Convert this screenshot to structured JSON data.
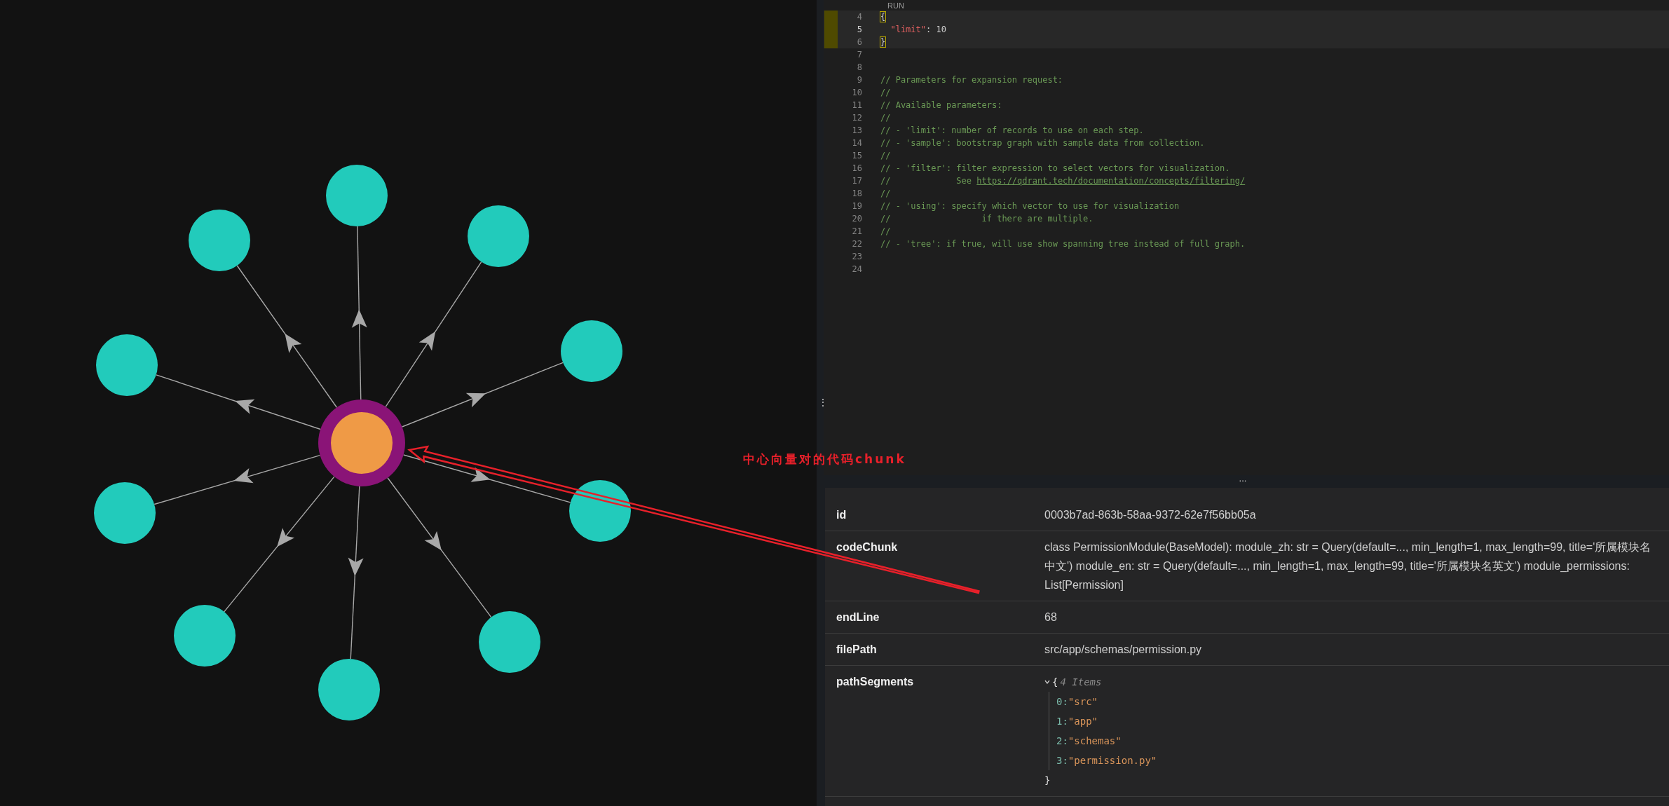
{
  "annotation": {
    "text": "中心向量对的代码chunk"
  },
  "editor": {
    "run_label": "RUN",
    "lines": [
      {
        "number": "4",
        "highlighted": true,
        "current": false,
        "tokens": [
          {
            "kind": "bracket",
            "text": "{"
          }
        ]
      },
      {
        "number": "5",
        "highlighted": true,
        "current": true,
        "tokens": [
          {
            "kind": "key",
            "text": "  \"limit\""
          },
          {
            "kind": "plain",
            "text": ": 10"
          }
        ]
      },
      {
        "number": "6",
        "highlighted": true,
        "current": false,
        "tokens": [
          {
            "kind": "bracket",
            "text": "}"
          }
        ]
      },
      {
        "number": "7",
        "highlighted": false,
        "current": false
      },
      {
        "number": "8",
        "highlighted": false,
        "current": false
      },
      {
        "number": "9",
        "highlighted": false,
        "current": false,
        "tokens": [
          {
            "kind": "comment",
            "text": "// Parameters for expansion request:"
          }
        ]
      },
      {
        "number": "10",
        "highlighted": false,
        "current": false,
        "tokens": [
          {
            "kind": "comment",
            "text": "//"
          }
        ]
      },
      {
        "number": "11",
        "highlighted": false,
        "current": false,
        "tokens": [
          {
            "kind": "comment",
            "text": "// Available parameters:"
          }
        ]
      },
      {
        "number": "12",
        "highlighted": false,
        "current": false,
        "tokens": [
          {
            "kind": "comment",
            "text": "//"
          }
        ]
      },
      {
        "number": "13",
        "highlighted": false,
        "current": false,
        "tokens": [
          {
            "kind": "comment",
            "text": "// - 'limit': number of records to use on each step."
          }
        ]
      },
      {
        "number": "14",
        "highlighted": false,
        "current": false,
        "tokens": [
          {
            "kind": "comment",
            "text": "// - 'sample': bootstrap graph with sample data from collection."
          }
        ]
      },
      {
        "number": "15",
        "highlighted": false,
        "current": false,
        "tokens": [
          {
            "kind": "comment",
            "text": "//"
          }
        ]
      },
      {
        "number": "16",
        "highlighted": false,
        "current": false,
        "tokens": [
          {
            "kind": "comment",
            "text": "// - 'filter': filter expression to select vectors for visualization."
          }
        ]
      },
      {
        "number": "17",
        "highlighted": false,
        "current": false,
        "tokens": [
          {
            "kind": "comment",
            "text": "//             See "
          },
          {
            "kind": "link",
            "text": "https://qdrant.tech/documentation/concepts/filtering/"
          }
        ]
      },
      {
        "number": "18",
        "highlighted": false,
        "current": false,
        "tokens": [
          {
            "kind": "comment",
            "text": "//"
          }
        ]
      },
      {
        "number": "19",
        "highlighted": false,
        "current": false,
        "tokens": [
          {
            "kind": "comment",
            "text": "// - 'using': specify which vector to use for visualization"
          }
        ]
      },
      {
        "number": "20",
        "highlighted": false,
        "current": false,
        "tokens": [
          {
            "kind": "comment",
            "text": "//                  if there are multiple."
          }
        ]
      },
      {
        "number": "21",
        "highlighted": false,
        "current": false,
        "tokens": [
          {
            "kind": "comment",
            "text": "//"
          }
        ]
      },
      {
        "number": "22",
        "highlighted": false,
        "current": false,
        "tokens": [
          {
            "kind": "comment",
            "text": "// - 'tree': if true, will use show spanning tree instead of full graph."
          }
        ]
      },
      {
        "number": "23",
        "highlighted": false,
        "current": false
      },
      {
        "number": "24",
        "highlighted": false,
        "current": false
      }
    ]
  },
  "splitter": {
    "handle": "...",
    "side_handle": "⋮"
  },
  "details": {
    "rows": [
      {
        "kind": "text",
        "key": "id",
        "value": "0003b7ad-863b-58aa-9372-62e7f56bb05a"
      },
      {
        "kind": "text",
        "key": "codeChunk",
        "value": "class PermissionModule(BaseModel): module_zh: str = Query(default=..., min_length=1, max_length=99, title='所属模块名中文') module_en: str = Query(default=..., min_length=1, max_length=99, title='所属模块名英文') module_permissions: List[Permission]"
      },
      {
        "kind": "text",
        "key": "endLine",
        "value": "68"
      },
      {
        "kind": "text",
        "key": "filePath",
        "value": "src/app/schemas/permission.py"
      },
      {
        "kind": "tree",
        "key": "pathSegments",
        "expanded": true,
        "open": "{",
        "summary": "4 Items",
        "close": "}",
        "items": [
          {
            "index": "0:",
            "value": "\"src\""
          },
          {
            "index": "1:",
            "value": "\"app\""
          },
          {
            "index": "2:",
            "value": "\"schemas\""
          },
          {
            "index": "3:",
            "value": "\"permission.py\""
          }
        ]
      }
    ]
  }
}
